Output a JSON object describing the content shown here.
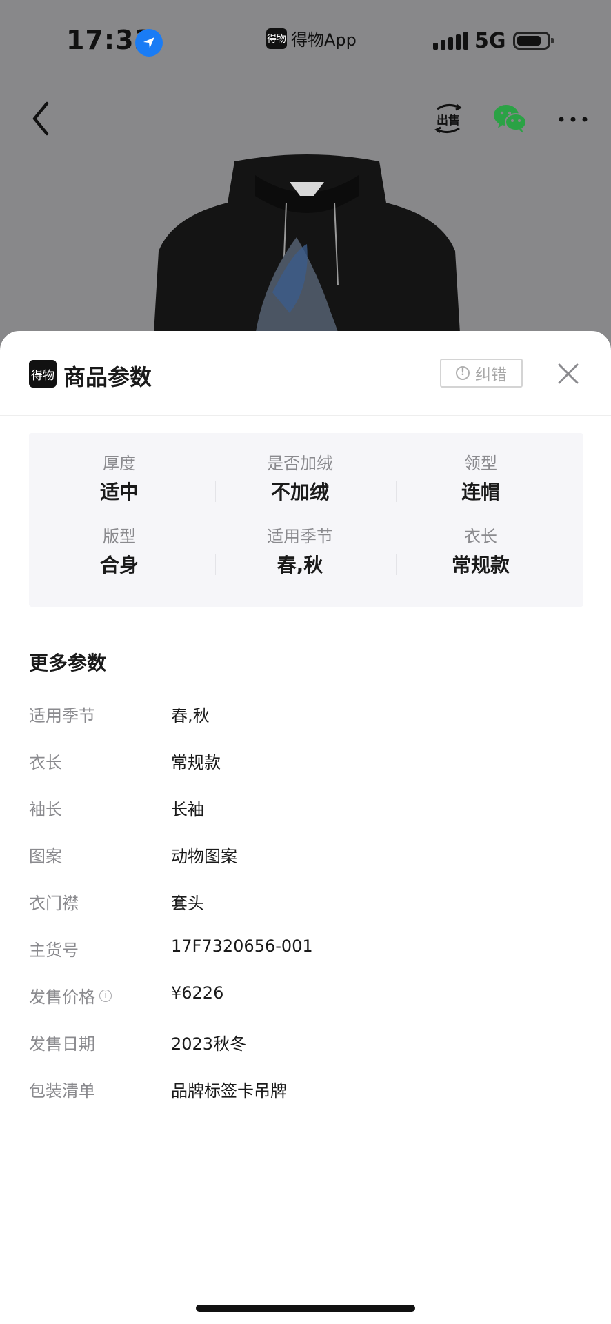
{
  "status_bar": {
    "time": "17:33",
    "app_name": "得物App",
    "app_logo_text": "得物",
    "network": "5G",
    "icons": [
      "location-arrow-icon",
      "signal-icon",
      "battery-icon"
    ]
  },
  "nav": {
    "icons": [
      "back-icon",
      "sell-icon",
      "wechat-icon",
      "more-icon"
    ],
    "sell_label": "出售"
  },
  "colors": {
    "accent_blue": "#1a7cf5",
    "wechat_green": "#2ba245",
    "sheet_panel": "#f6f6f9",
    "muted_text": "#8a8a8e"
  },
  "sheet": {
    "logo_text": "得物",
    "title": "商品参数",
    "correct_button": "纠错",
    "close_icon": "close-icon"
  },
  "key_params": [
    {
      "label": "厚度",
      "value": "适中"
    },
    {
      "label": "是否加绒",
      "value": "不加绒"
    },
    {
      "label": "领型",
      "value": "连帽"
    },
    {
      "label": "版型",
      "value": "合身"
    },
    {
      "label": "适用季节",
      "value": "春,秋"
    },
    {
      "label": "衣长",
      "value": "常规款"
    }
  ],
  "more_params": {
    "title": "更多参数",
    "rows": [
      {
        "key": "适用季节",
        "value": "春,秋"
      },
      {
        "key": "衣长",
        "value": "常规款"
      },
      {
        "key": "袖长",
        "value": "长袖"
      },
      {
        "key": "图案",
        "value": "动物图案"
      },
      {
        "key": "衣门襟",
        "value": "套头"
      },
      {
        "key": "主货号",
        "value": "17F7320656-001"
      },
      {
        "key": "发售价格",
        "value": "¥6226",
        "info_icon": true
      },
      {
        "key": "发售日期",
        "value": "2023秋冬"
      },
      {
        "key": "包装清单",
        "value": "品牌标签卡吊牌"
      }
    ]
  }
}
